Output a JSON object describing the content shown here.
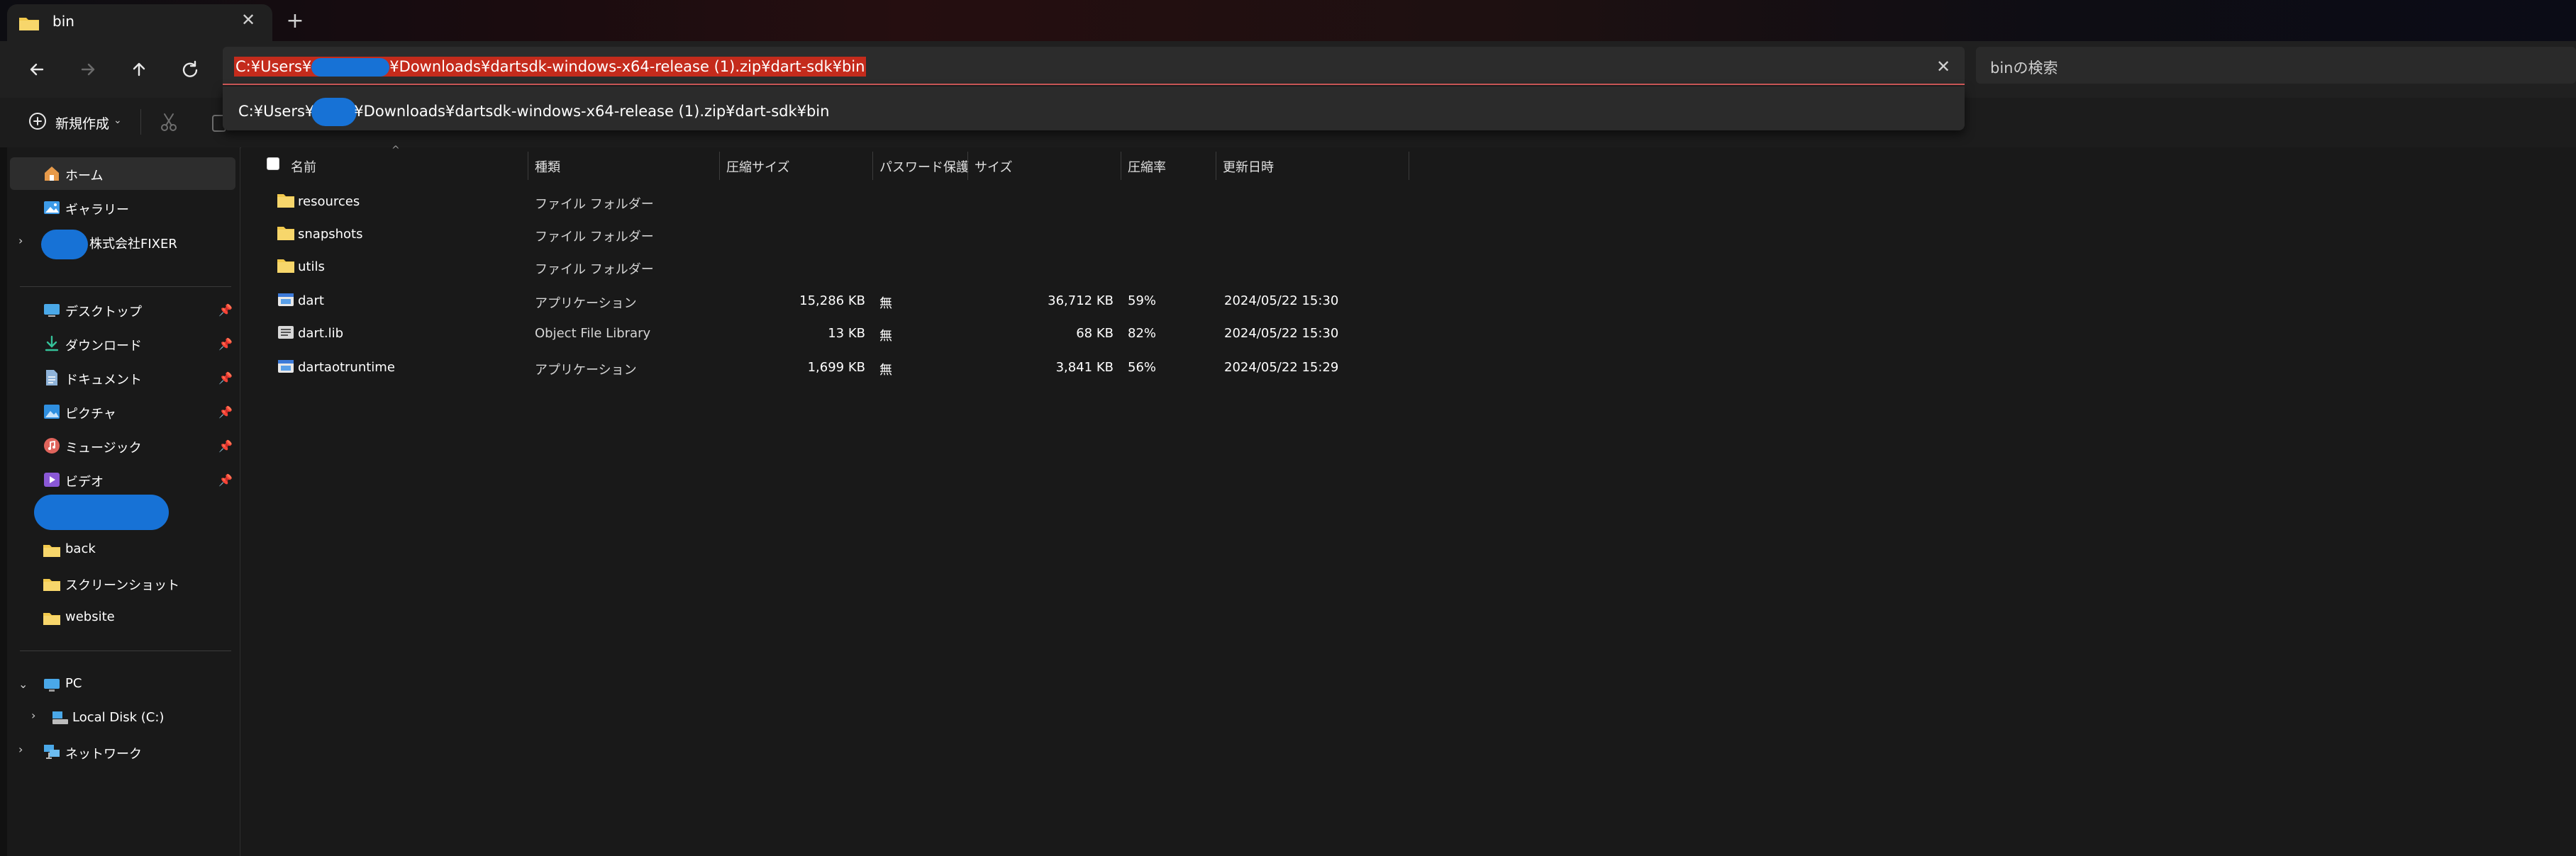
{
  "window": {
    "tab_title": "bin",
    "tab_close": "✕",
    "new_tab": "+"
  },
  "address_bar": {
    "path": "C:¥Users¥",
    "path_rest": "¥Downloads¥dartsdk-windows-x64-release (1).zip¥dart-sdk¥bin",
    "clear": "✕",
    "suggestion": "C:¥Users¥",
    "suggestion_rest": "¥Downloads¥dartsdk-windows-x64-release (1).zip¥dart-sdk¥bin"
  },
  "search": {
    "placeholder": "binの検索"
  },
  "toolbar": {
    "new_label": "新規作成",
    "new_chevron": "⌄"
  },
  "navpane": {
    "items": [
      {
        "label": "ホーム",
        "icon": "home-icon",
        "selected": true
      },
      {
        "label": "ギャラリー",
        "icon": "gallery-icon"
      },
      {
        "label": "株式会社FIXER",
        "icon": "onedrive-cloud-icon"
      },
      {
        "label": "デスクトップ",
        "icon": "desktop-icon",
        "pinned": true
      },
      {
        "label": "ダウンロード",
        "icon": "download-icon",
        "pinned": true
      },
      {
        "label": "ドキュメント",
        "icon": "document-icon",
        "pinned": true
      },
      {
        "label": "ピクチャ",
        "icon": "pictures-icon",
        "pinned": true
      },
      {
        "label": "ミュージック",
        "icon": "music-icon",
        "pinned": true
      },
      {
        "label": "ビデオ",
        "icon": "video-icon",
        "pinned": true
      },
      {
        "label": "back",
        "icon": "folder-icon"
      },
      {
        "label": "スクリーンショット",
        "icon": "folder-icon"
      },
      {
        "label": "website",
        "icon": "folder-icon"
      },
      {
        "label": "PC",
        "icon": "pc-icon"
      },
      {
        "label": "Local Disk (C:)",
        "icon": "drive-icon"
      },
      {
        "label": "ネットワーク",
        "icon": "network-icon"
      }
    ]
  },
  "columns": [
    "名前",
    "種類",
    "圧縮サイズ",
    "パスワード保護",
    "サイズ",
    "圧縮率",
    "更新日時"
  ],
  "files": [
    {
      "name": "resources",
      "type": "ファイル フォルダー",
      "compressed": "",
      "password": "",
      "size": "",
      "ratio": "",
      "modified": "",
      "icon": "folder-icon"
    },
    {
      "name": "snapshots",
      "type": "ファイル フォルダー",
      "compressed": "",
      "password": "",
      "size": "",
      "ratio": "",
      "modified": "",
      "icon": "folder-icon"
    },
    {
      "name": "utils",
      "type": "ファイル フォルダー",
      "compressed": "",
      "password": "",
      "size": "",
      "ratio": "",
      "modified": "",
      "icon": "folder-icon"
    },
    {
      "name": "dart",
      "type": "アプリケーション",
      "compressed": "15,286 KB",
      "password": "無",
      "size": "36,712 KB",
      "ratio": "59%",
      "modified": "2024/05/22 15:30",
      "icon": "application-icon"
    },
    {
      "name": "dart.lib",
      "type": "Object File Library",
      "compressed": "13 KB",
      "password": "無",
      "size": "68 KB",
      "ratio": "82%",
      "modified": "2024/05/22 15:30",
      "icon": "library-file-icon"
    },
    {
      "name": "dartaotruntime",
      "type": "アプリケーション",
      "compressed": "1,699 KB",
      "password": "無",
      "size": "3,841 KB",
      "ratio": "56%",
      "modified": "2024/05/22 15:29",
      "icon": "application-icon"
    }
  ],
  "colors": {
    "accent_red": "#c42b1c",
    "folder_yellow": "#f2c94c",
    "scribble_blue": "#1772d6"
  }
}
